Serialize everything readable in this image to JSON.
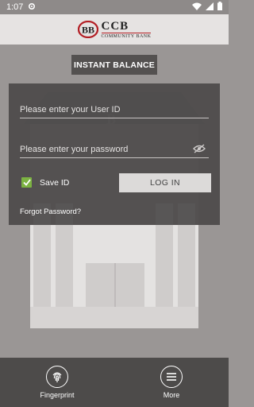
{
  "status_bar": {
    "time": "1:07"
  },
  "logo": {
    "name": "CCB",
    "subtitle": "COMMUNITY BANK"
  },
  "instant_balance": {
    "label": "INSTANT BALANCE"
  },
  "login": {
    "user_placeholder": "Please enter your User ID",
    "password_placeholder": "Please enter your password",
    "save_id_label": "Save ID",
    "save_id_checked": true,
    "login_button": "LOG IN",
    "forgot_password": "Forgot Password?"
  },
  "bottom_nav": {
    "fingerprint": "Fingerprint",
    "more": "More"
  },
  "colors": {
    "background": "#9a9695",
    "panel": "#484645",
    "accent_check": "#7cb342",
    "logo_red": "#b31e24"
  }
}
